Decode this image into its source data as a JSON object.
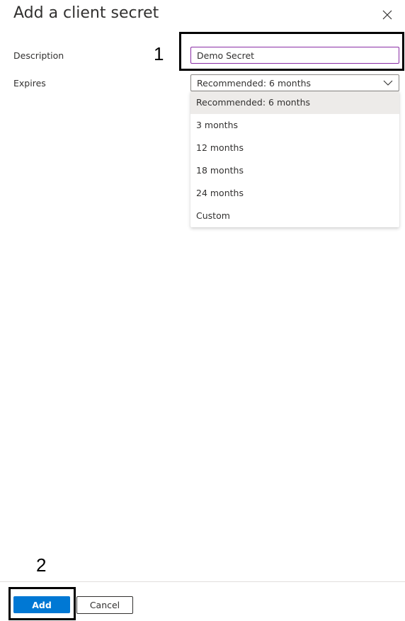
{
  "panel": {
    "title": "Add a client secret",
    "close_icon": "close-icon"
  },
  "form": {
    "description": {
      "label": "Description",
      "value": "Demo Secret"
    },
    "expires": {
      "label": "Expires",
      "selected": "Recommended: 6 months",
      "options": [
        "Recommended: 6 months",
        "3 months",
        "12 months",
        "18 months",
        "24 months",
        "Custom"
      ],
      "chevron_icon": "chevron-down-icon"
    }
  },
  "footer": {
    "add_label": "Add",
    "cancel_label": "Cancel"
  },
  "annotations": {
    "step1": "1",
    "step2": "2"
  },
  "colors": {
    "primary": "#0078d4",
    "focus_border": "#8a2da5",
    "selected_option_bg": "#edebe9"
  }
}
